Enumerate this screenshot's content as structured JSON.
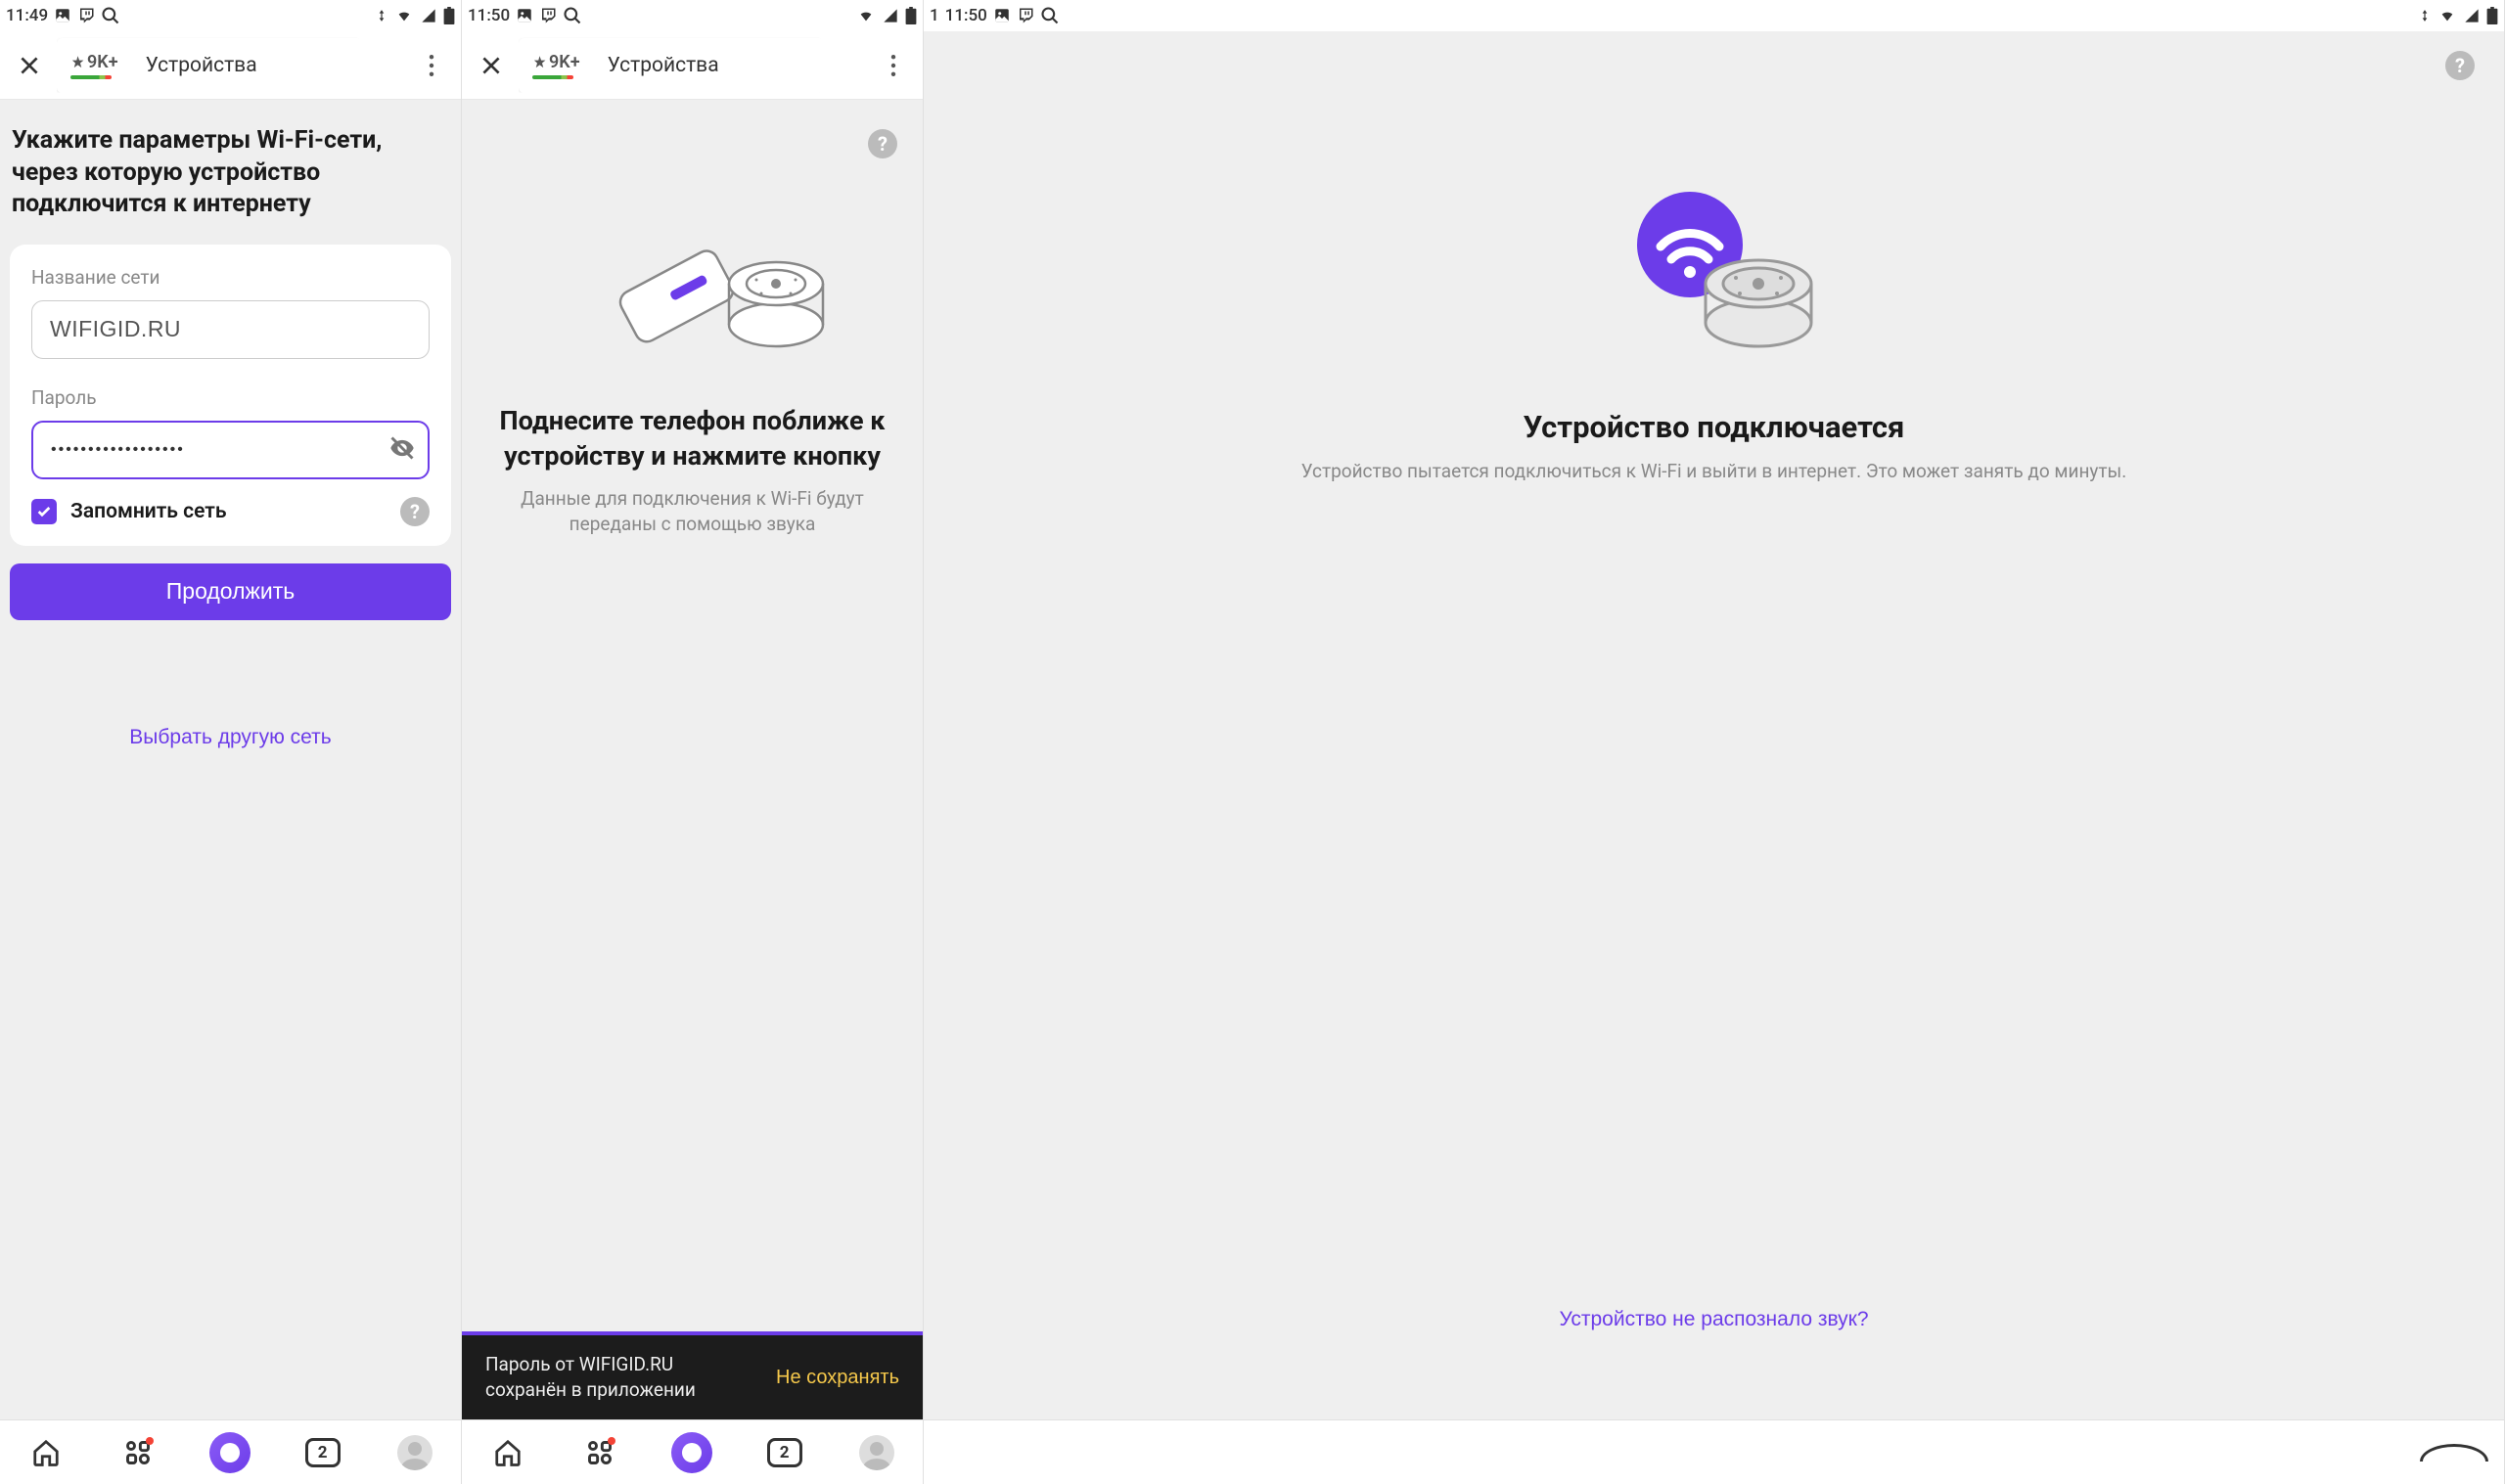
{
  "status": {
    "time1": "11:49",
    "time2": "11:50",
    "time3": "11:50",
    "time3_prefix": "1"
  },
  "tab": {
    "rating": "9K+",
    "title": "Устройства"
  },
  "screen1": {
    "heading": "Укажите параметры Wi-Fi-сети, через которую устройство подключится к интернету",
    "network_label": "Название сети",
    "network_value": "WIFIGID.RU",
    "password_label": "Пароль",
    "password_value": "••••••••••••••••••",
    "remember_label": "Запомнить сеть",
    "continue_btn": "Продолжить",
    "other_network_link": "Выбрать другую сеть"
  },
  "screen2": {
    "title": "Поднесите телефон поближе к устройству и нажмите кнопку",
    "subtitle": "Данные для подключения к Wi-Fi будут переданы с помощью звука",
    "snackbar_line1": "Пароль от WIFIGID.RU",
    "snackbar_line2": "сохранён в приложении",
    "snackbar_action": "Не сохранять"
  },
  "screen3": {
    "title": "Устройство подключается",
    "subtitle": "Устройство пытается подключиться к Wi-Fi и выйти в интернет. Это может занять до минуты.",
    "link": "Устройство не распознало звук?"
  },
  "nav": {
    "tabs_count": "2"
  }
}
